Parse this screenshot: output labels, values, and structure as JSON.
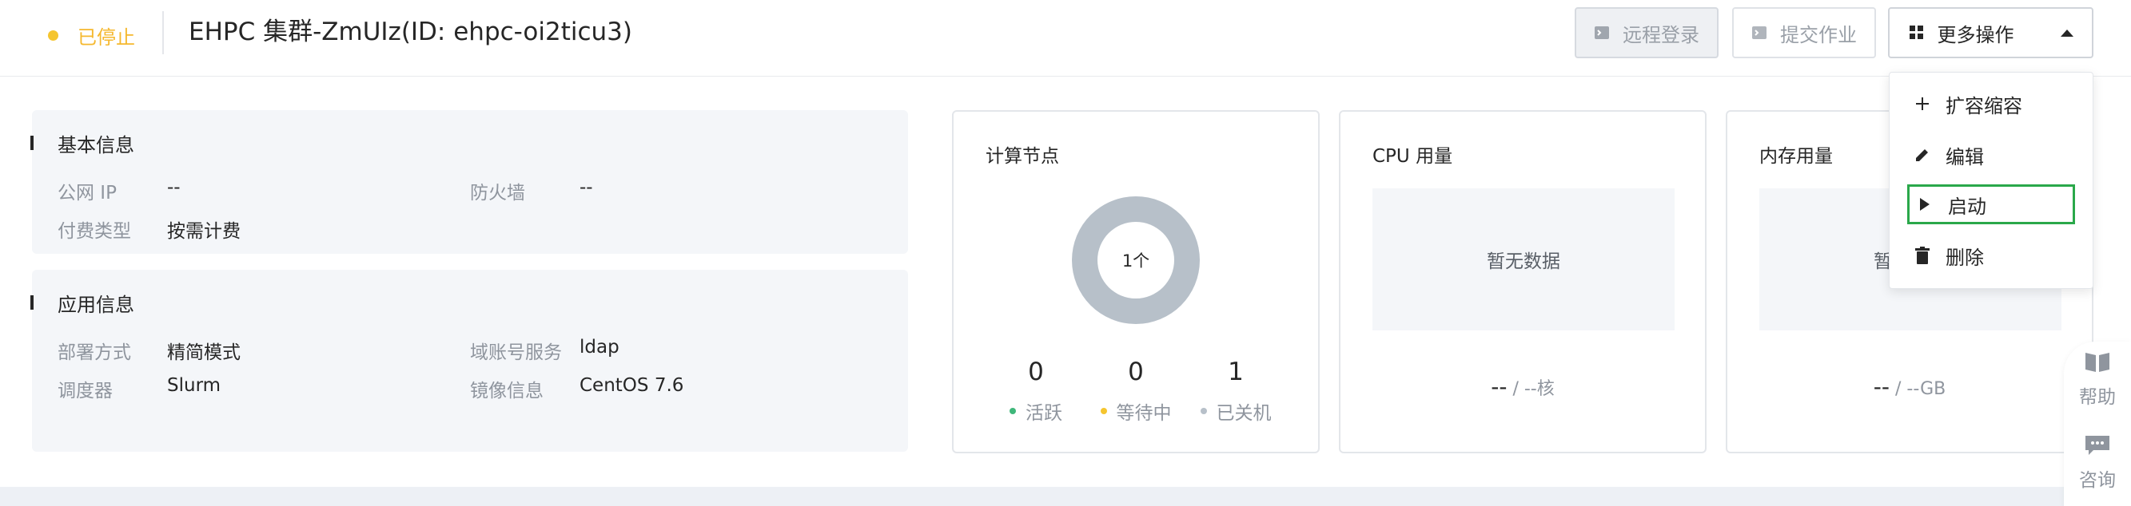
{
  "header": {
    "status_label": "已停止",
    "status_color": "#f5c52f",
    "title": "EHPC 集群-ZmUIz(ID: ehpc-oi2ticu3)",
    "buttons": {
      "remote_login": "远程登录",
      "submit_job": "提交作业",
      "more_actions": "更多操作"
    }
  },
  "basic_info": {
    "title": "基本信息",
    "public_ip_label": "公网 IP",
    "public_ip_value": "--",
    "firewall_label": "防火墙",
    "firewall_value": "--",
    "billing_label": "付费类型",
    "billing_value": "按需计费"
  },
  "app_info": {
    "title": "应用信息",
    "deploy_label": "部署方式",
    "deploy_value": "精简模式",
    "domain_label": "域账号服务",
    "domain_value": "ldap",
    "scheduler_label": "调度器",
    "scheduler_value": "Slurm",
    "image_label": "镜像信息",
    "image_value": "CentOS 7.6"
  },
  "nodes": {
    "title": "计算节点",
    "total": "1个",
    "stats": [
      {
        "value": "0",
        "label": "活跃",
        "color": "#3fb77a"
      },
      {
        "value": "0",
        "label": "等待中",
        "color": "#f5c52f"
      },
      {
        "value": "1",
        "label": "已关机",
        "color": "#b7c0c9"
      }
    ]
  },
  "cpu": {
    "title": "CPU 用量",
    "no_data": "暂无数据",
    "value": "--",
    "unit": "/ --核"
  },
  "memory": {
    "title": "内存用量",
    "no_data": "暂无数据",
    "value": "--",
    "unit": "/ --GB"
  },
  "dropdown": {
    "items": [
      {
        "label": "扩容缩容",
        "icon": "plus-icon"
      },
      {
        "label": "编辑",
        "icon": "pencil-icon"
      },
      {
        "label": "启动",
        "icon": "play-icon",
        "highlighted": true
      },
      {
        "label": "删除",
        "icon": "trash-icon"
      }
    ]
  },
  "float_bar": {
    "help": "帮助",
    "consult": "咨询"
  }
}
